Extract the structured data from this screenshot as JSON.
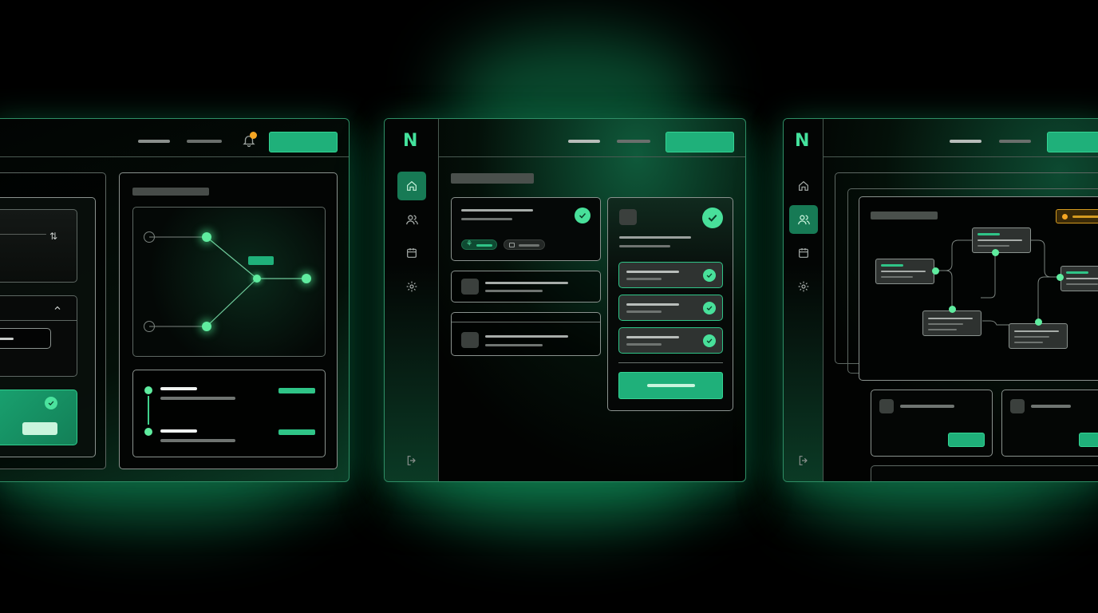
{
  "screen": {
    "background": "#000000",
    "accent": "#1fb07a",
    "accent_bright": "#48e09a",
    "notification_dot": "#f5a623"
  },
  "windows": [
    {
      "name": "left-window",
      "topbar": {
        "has_bell": true,
        "bell_icon": "bell-icon"
      },
      "panels": [
        "settings-panel",
        "graph-panel"
      ],
      "graph": {
        "chip_text": ""
      }
    },
    {
      "name": "center-window",
      "logo": "N",
      "sidebar": [
        "home-icon",
        "users-icon",
        "calendar-icon",
        "gear-icon",
        "logout-icon"
      ],
      "active_nav": "home-icon"
    },
    {
      "name": "right-window",
      "logo": "N",
      "sidebar": [
        "home-icon",
        "users-icon",
        "calendar-icon",
        "gear-icon",
        "logout-icon"
      ],
      "active_nav": "users-icon"
    }
  ]
}
